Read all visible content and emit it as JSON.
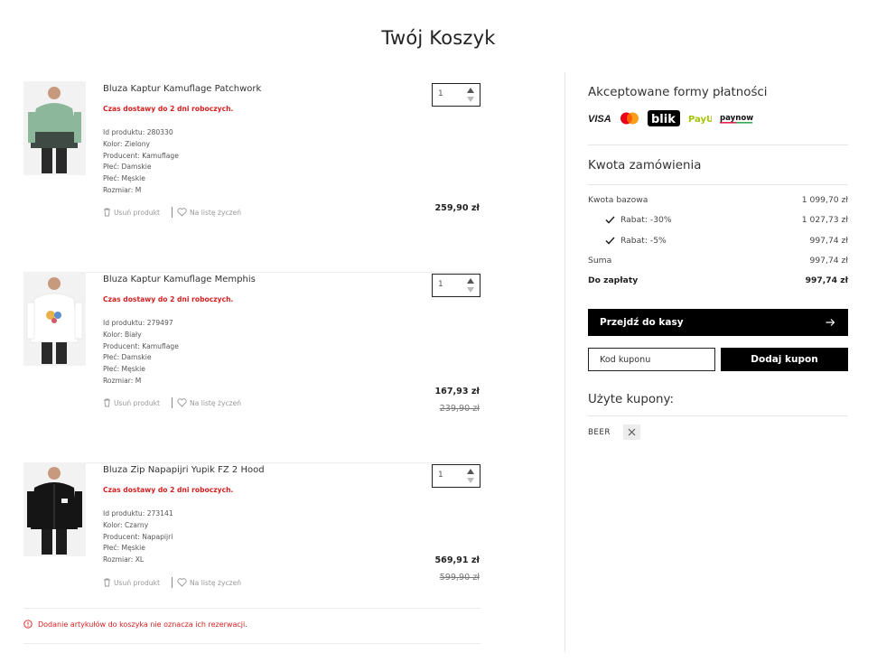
{
  "page_title": "Twój Koszyk",
  "items": [
    {
      "name": "Bluza Kaptur Kamuflage Patchwork",
      "delivery": "Czas dostawy do 2 dni roboczych.",
      "attrs": [
        "Id produktu: 280330",
        "Kolor: Zielony",
        "Producent: Kamuflage",
        "Płeć: Damskie",
        "Płeć: Męskie",
        "Rozmiar: M"
      ],
      "remove_label": "Usuń produkt",
      "wishlist_label": "Na listę życzeń",
      "qty": "1",
      "price": "259,90 zł",
      "old_price": ""
    },
    {
      "name": "Bluza Kaptur Kamuflage Memphis",
      "delivery": "Czas dostawy do 2 dni roboczych.",
      "attrs": [
        "Id produktu: 279497",
        "Kolor: Biały",
        "Producent: Kamuflage",
        "Płeć: Damskie",
        "Płeć: Męskie",
        "Rozmiar: M"
      ],
      "remove_label": "Usuń produkt",
      "wishlist_label": "Na listę życzeń",
      "qty": "1",
      "price": "167,93 zł",
      "old_price": "239,90 zł"
    },
    {
      "name": "Bluza Zip Napapijri Yupik FZ 2 Hood",
      "delivery": "Czas dostawy do 2 dni roboczych.",
      "attrs": [
        "Id produktu: 273141",
        "Kolor: Czarny",
        "Producent: Napapijri",
        "Płeć: Męskie",
        "Rozmiar: XL"
      ],
      "remove_label": "Usuń produkt",
      "wishlist_label": "Na listę życzeń",
      "qty": "1",
      "price": "569,91 zł",
      "old_price": "599,90 zł"
    }
  ],
  "notice": "Dodanie artykułów do koszyka nie oznacza ich rezerwacji.",
  "summary": {
    "payments_title": "Akceptowane formy płatności",
    "payment_logos": [
      "VISA",
      "mastercard",
      "blik",
      "PayU",
      "paynow"
    ],
    "order_title": "Kwota zamówienia",
    "base_label": "Kwota bazowa",
    "base_value": "1 099,70 zł",
    "discount1_label": "Rabat: -30%",
    "discount1_value": "1 027,73 zł",
    "discount2_label": "Rabat: -5%",
    "discount2_value": "997,74 zł",
    "sum_label": "Suma",
    "sum_value": "997,74 zł",
    "topay_label": "Do zapłaty",
    "topay_value": "997,74 zł",
    "checkout_label": "Przejdź do kasy",
    "coupon_placeholder": "Kod kuponu",
    "coupon_button": "Dodaj kupon",
    "used_coupons_title": "Użyte kupony:",
    "used_coupon_code": "BEER"
  },
  "colors": {
    "accent_red": "#d42020",
    "button_black": "#000000"
  }
}
